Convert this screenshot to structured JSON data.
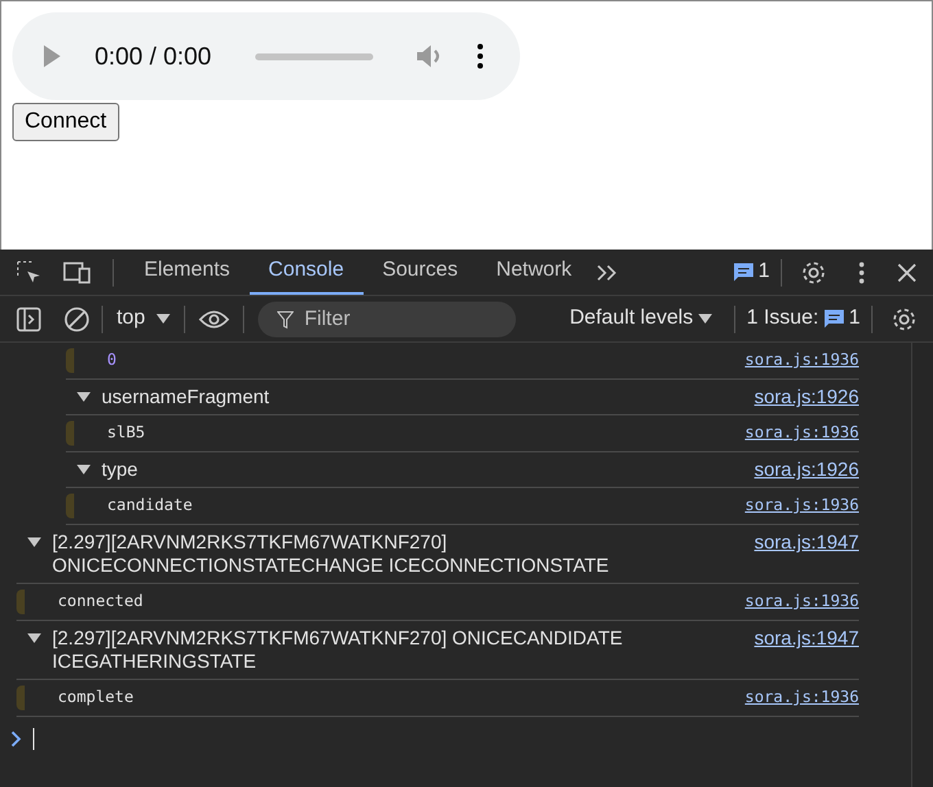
{
  "page": {
    "audio_player": {
      "time": "0:00 / 0:00"
    },
    "connect_button": "Connect"
  },
  "devtools": {
    "tabs": [
      {
        "label": "Elements",
        "selected": false
      },
      {
        "label": "Console",
        "selected": true
      },
      {
        "label": "Sources",
        "selected": false
      },
      {
        "label": "Network",
        "selected": false
      }
    ],
    "message_count": "1",
    "console_toolbar": {
      "context": "top",
      "filter_placeholder": "Filter",
      "levels": "Default levels",
      "issues_label": "1 Issue:",
      "issues_count": "1"
    },
    "log": [
      {
        "kind": "group",
        "children": [
          {
            "kind": "number",
            "text": "0",
            "source": "sora.js:1936"
          },
          {
            "kind": "group",
            "expanded": true,
            "title": "usernameFragment",
            "source": "sora.js:1926",
            "children": [
              {
                "kind": "string",
                "text": "slB5",
                "source": "sora.js:1936"
              }
            ]
          },
          {
            "kind": "group",
            "expanded": true,
            "title": "type",
            "source": "sora.js:1926",
            "children": [
              {
                "kind": "string",
                "text": "candidate",
                "source": "sora.js:1936"
              }
            ]
          }
        ]
      },
      {
        "kind": "group",
        "expanded": true,
        "title": "[2.297][2ARVNM2RKS7TKFM67WATKNF270] ONICECONNECTIONSTATECHANGE ICECONNECTIONSTATE",
        "source": "sora.js:1947",
        "children": [
          {
            "kind": "string",
            "text": "connected",
            "source": "sora.js:1936"
          }
        ]
      },
      {
        "kind": "group",
        "expanded": true,
        "title": "[2.297][2ARVNM2RKS7TKFM67WATKNF270] ONICECANDIDATE ICEGATHERINGSTATE",
        "source": "sora.js:1947",
        "children": [
          {
            "kind": "string",
            "text": "complete",
            "source": "sora.js:1936"
          }
        ]
      }
    ]
  }
}
